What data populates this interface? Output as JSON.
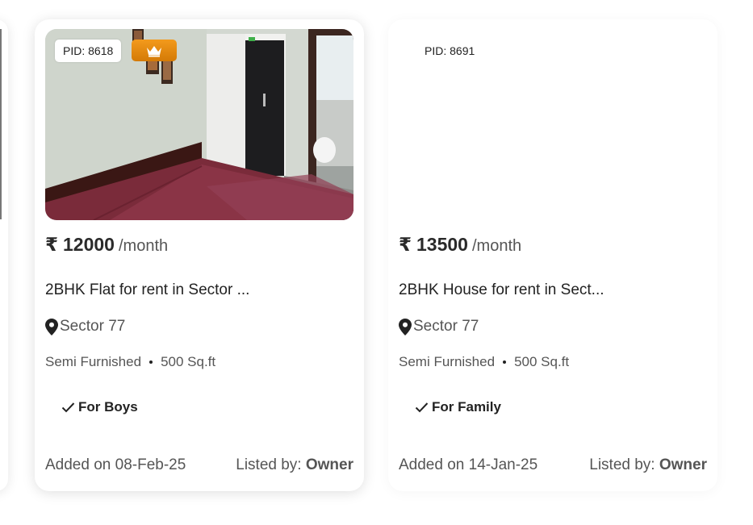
{
  "listings": [
    {
      "pid": "PID: 8618",
      "premium": true,
      "premium_icon": "crown-icon",
      "image": "furnished-room-photo",
      "currency": "₹",
      "price": "12000",
      "period": "/month",
      "title": "2BHK Flat for rent in Sector ...",
      "location": "Sector 77",
      "furnishing": "Semi Furnished",
      "area": "500 Sq.ft",
      "tenant": "For Boys",
      "added": "Added on 08-Feb-25",
      "listed_by_label": "Listed by:",
      "listed_by": "Owner"
    },
    {
      "pid": "PID: 8691",
      "premium": false,
      "currency": "₹",
      "price": "13500",
      "period": "/month",
      "title": "2BHK House for rent in Sect...",
      "location": "Sector 77",
      "furnishing": "Semi Furnished",
      "area": "500 Sq.ft",
      "tenant": "For Family",
      "added": "Added on 14-Jan-25",
      "listed_by_label": "Listed by:",
      "listed_by": "Owner"
    }
  ],
  "colors": {
    "premium_badge": "#e68a0f",
    "text_primary": "#222222",
    "text_secondary": "#555555"
  }
}
